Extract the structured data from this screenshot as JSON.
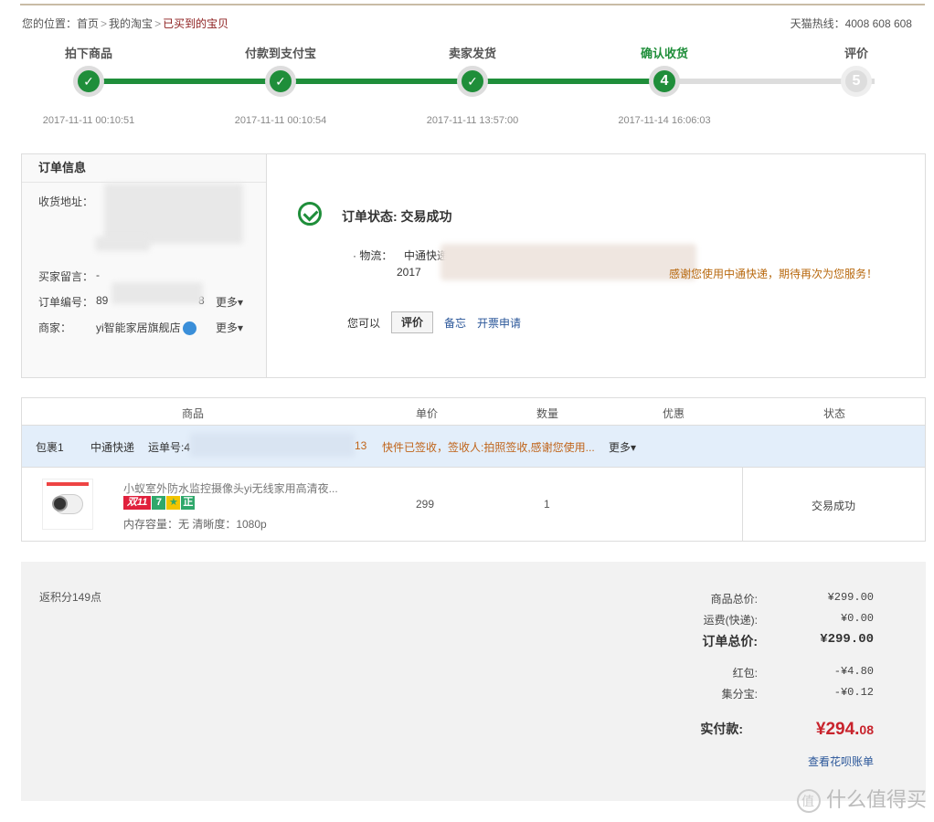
{
  "breadcrumb": {
    "prefix": "您的位置：",
    "items": [
      "首页",
      "我的淘宝"
    ],
    "current": "已买到的宝贝"
  },
  "hotline": "天猫热线：4008 608 608",
  "steps": [
    {
      "label": "拍下商品",
      "time": "2017-11-11 00:10:51",
      "mark": "✓",
      "state": "done"
    },
    {
      "label": "付款到支付宝",
      "time": "2017-11-11 00:10:54",
      "mark": "✓",
      "state": "done"
    },
    {
      "label": "卖家发货",
      "time": "2017-11-11 13:57:00",
      "mark": "✓",
      "state": "done"
    },
    {
      "label": "确认收货",
      "time": "2017-11-14 16:06:03",
      "mark": "4",
      "state": "active"
    },
    {
      "label": "评价",
      "time": "",
      "mark": "5",
      "state": "todo"
    }
  ],
  "order_info": {
    "heading": "订单信息",
    "address_label": "收货地址：",
    "message_label": "买家留言：",
    "message_value": "-",
    "order_no_label": "订单编号：",
    "order_no_prefix": "89",
    "order_no_suffix": "8",
    "merchant_label": "商家：",
    "merchant_name": "yi智能家居旗舰店",
    "more": "更多"
  },
  "status": {
    "title": "订单状态: 交易成功",
    "logistics_label": "· 物流：",
    "logistics_company": "中通快递",
    "logistics_date_prefix": "2017",
    "logistics_msg": "感谢您使用中通快递，期待再次为您服务！",
    "can_do": "您可以",
    "review_btn": "评价",
    "memo_link": "备忘",
    "invoice_link": "开票申请"
  },
  "goods_table": {
    "headers": [
      "商品",
      "单价",
      "数量",
      "优惠",
      "状态"
    ],
    "package": {
      "name": "包裹1",
      "carrier": "中通快递",
      "tracking_label": "运单号:4",
      "status_time": "13",
      "status_text": "快件已签收，签收人:拍照签收,感谢您使用...",
      "more": "更多"
    },
    "item": {
      "title": "小蚁室外防水监控摄像头yi无线家用高清夜...",
      "badges": [
        "双11",
        "7",
        "★",
        "正"
      ],
      "attrs": "内存容量：无  清晰度：1080p",
      "price": "299",
      "qty": "1",
      "status": "交易成功"
    }
  },
  "summary": {
    "points": "返积分149点",
    "rows": [
      {
        "label": "商品总价:",
        "value": "¥299.00"
      },
      {
        "label": "运费(快递):",
        "value": "¥0.00"
      },
      {
        "label": "订单总价:",
        "value": "¥299.00"
      },
      {
        "label": "红包:",
        "value": "-¥4.80"
      },
      {
        "label": "集分宝:",
        "value": "-¥0.12"
      }
    ],
    "paid_label": "实付款:",
    "paid_main": "¥294.",
    "paid_cents": "08",
    "huabei_link": "查看花呗账单"
  },
  "watermark": "什么值得买",
  "colors": {
    "green": "#1f8e3a",
    "price_red": "#c8232c",
    "link_blue": "#2a5699",
    "orange": "#b8690f"
  }
}
